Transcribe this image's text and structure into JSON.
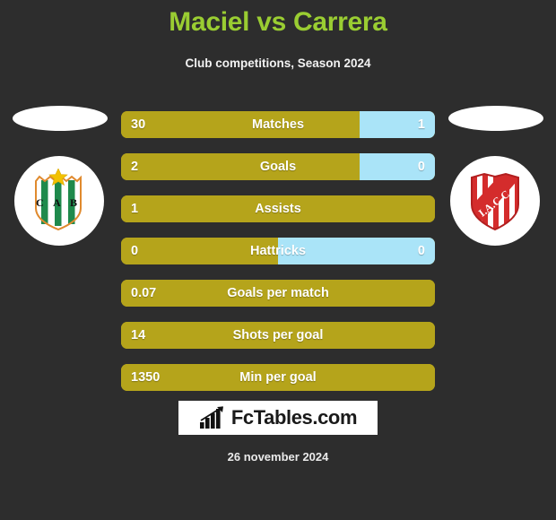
{
  "header": {
    "title": "Maciel vs Carrera",
    "subtitle": "Club competitions, Season 2024",
    "title_color": "#9acd32"
  },
  "teams": {
    "left": {
      "name": "left-team-badge",
      "abbr": "C A B",
      "colors": {
        "primary": "#1f8a4c",
        "secondary": "#ffffff",
        "accent": "#f2c100"
      }
    },
    "right": {
      "name": "right-team-badge",
      "abbr": "I.A.C.C.",
      "colors": {
        "primary": "#d42c2c",
        "secondary": "#ffffff"
      }
    }
  },
  "theme": {
    "background": "#2d2d2d",
    "bar_left_color": "#b5a41b",
    "bar_right_color": "#aae4f8"
  },
  "chart_data": {
    "type": "bar",
    "title": "Maciel vs Carrera",
    "subtitle": "Club competitions, Season 2024",
    "orientation": "horizontal-split",
    "series": [
      {
        "name": "Maciel",
        "color": "#b5a41b"
      },
      {
        "name": "Carrera",
        "color": "#aae4f8"
      }
    ],
    "categories": [
      "Matches",
      "Goals",
      "Assists",
      "Hattricks",
      "Goals per match",
      "Shots per goal",
      "Min per goal"
    ],
    "rows": [
      {
        "label": "Matches",
        "left": "30",
        "right": "1",
        "left_pct": 76,
        "has_right": true
      },
      {
        "label": "Goals",
        "left": "2",
        "right": "0",
        "left_pct": 76,
        "has_right": true
      },
      {
        "label": "Assists",
        "left": "1",
        "right": "",
        "left_pct": 100,
        "has_right": false
      },
      {
        "label": "Hattricks",
        "left": "0",
        "right": "0",
        "left_pct": 50,
        "has_right": true
      },
      {
        "label": "Goals per match",
        "left": "0.07",
        "right": "",
        "left_pct": 100,
        "has_right": false
      },
      {
        "label": "Shots per goal",
        "left": "14",
        "right": "",
        "left_pct": 100,
        "has_right": false
      },
      {
        "label": "Min per goal",
        "left": "1350",
        "right": "",
        "left_pct": 100,
        "has_right": false
      }
    ]
  },
  "footer": {
    "logo_text": "FcTables.com",
    "logo_icon": "bar-chart-growth-icon",
    "date": "26 november 2024"
  }
}
